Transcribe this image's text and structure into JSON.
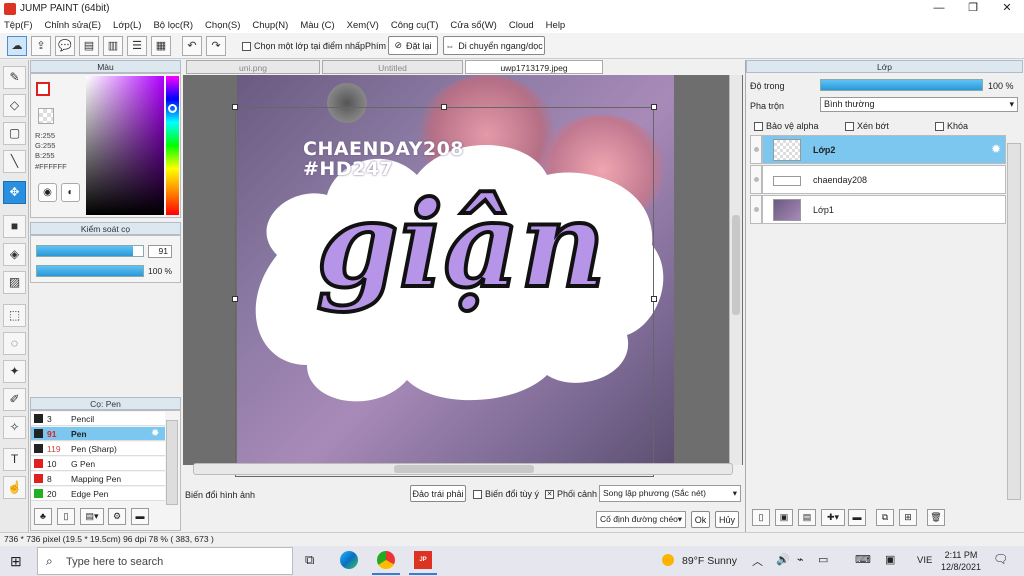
{
  "window": {
    "title": "JUMP PAINT (64bit)",
    "minimize": "—",
    "maximize": "❐",
    "close": "✕"
  },
  "menu": [
    "Tệp(F)",
    "Chỉnh sửa(E)",
    "Lớp(L)",
    "Bộ lọc(R)",
    "Chọn(S)",
    "Chụp(N)",
    "Màu (C)",
    "Xem(V)",
    "Công cụ(T)",
    "Cửa sổ(W)",
    "Cloud",
    "Help"
  ],
  "toolbar": {
    "select_layer_label": "Chọn một lớp tại điểm nhấp",
    "key_label": "Phím",
    "reset_label": "Đặt lại",
    "move_label": "Di chuyển ngang/dọc"
  },
  "color_panel": {
    "title": "Màu",
    "r": "R:255",
    "g": "G:255",
    "b": "B:255",
    "hex": "#FFFFFF"
  },
  "brush_control": {
    "title": "Kiểm soát cọ",
    "size_value": "91",
    "opacity_value": "100 %",
    "size_fraction": 0.91,
    "opacity_fraction": 1.0
  },
  "brush_panel": {
    "title": "Cọ: Pen",
    "items": [
      {
        "size": "3",
        "name": "Pencil",
        "color": "#222222"
      },
      {
        "size": "91",
        "name": "Pen",
        "color": "#222222",
        "selected": true
      },
      {
        "size": "119",
        "name": "Pen (Sharp)",
        "color": "#222222"
      },
      {
        "size": "10",
        "name": "G Pen",
        "color": "#e02020"
      },
      {
        "size": "8",
        "name": "Mapping Pen",
        "color": "#e02020"
      },
      {
        "size": "20",
        "name": "Edge Pen",
        "color": "#20b020"
      }
    ]
  },
  "tabs": [
    "uni.png",
    "Untitled",
    "uwp1713179.jpeg"
  ],
  "artwork": {
    "line1": "CHAENDAY208",
    "line2": "#HD247",
    "word": "giận"
  },
  "transform_bar": {
    "label": "Biến đổi hình ảnh",
    "flip_button": "Đảo trái phải",
    "free_transform": "Biến đổi tùy ý",
    "perspective": "Phối cảnh",
    "interp_select": "Song lập phương (Sắc nét)",
    "fixed_diag": "Cố định đường chéo",
    "ok": "Ok",
    "cancel": "Hủy"
  },
  "layer_panel": {
    "title": "Lớp",
    "opacity_label": "Độ trong",
    "opacity_value": "100 %",
    "opacity_fraction": 1.0,
    "blend_label": "Pha trộn",
    "blend_value": "Bình thường",
    "protect_alpha": "Bảo vệ alpha",
    "clip": "Xén bớt",
    "lock": "Khóa",
    "layers": [
      {
        "name": "Lớp2",
        "selected": true
      },
      {
        "name": "chaenday208"
      },
      {
        "name": "Lớp1"
      }
    ]
  },
  "statusbar": {
    "text": "736 * 736 pixel  (19.5 * 19.5cm)  96 dpi  78 %  ( 383, 673 )"
  },
  "taskbar": {
    "search_placeholder": "Type here to search",
    "weather": "89°F  Sunny",
    "lang": "VIE",
    "time": "2:11 PM",
    "date": "12/8/2021"
  }
}
